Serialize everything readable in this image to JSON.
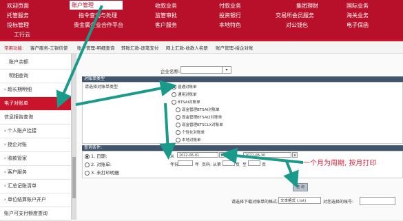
{
  "topnav": {
    "items": [
      {
        "label": "欢迎页面"
      },
      {
        "label": "账户管理"
      },
      {
        "label": "收款业务"
      },
      {
        "label": "付款业务"
      },
      {
        "label": "集团理财"
      },
      {
        "label": "国际业务"
      },
      {
        "label": "托管服务"
      },
      {
        "label": "指令查询与处理"
      },
      {
        "label": "监管审批"
      },
      {
        "label": "投资银行"
      },
      {
        "label": "交易所会员服务"
      },
      {
        "label": "海关业务"
      },
      {
        "label": "投标管理"
      },
      {
        "label": "贵金属企业合作平台"
      },
      {
        "label": "客户服务"
      },
      {
        "label": "本地特色"
      },
      {
        "label": "对公钱包"
      },
      {
        "label": "电子保函"
      },
      {
        "label": "工行云"
      }
    ]
  },
  "quickbar": {
    "label": "常用功能:",
    "items": [
      "客户服务-工银信使",
      "账户管理-明细查询",
      "转账汇款-逐笔支付",
      "网上汇款-收款人名册",
      "账户管理-授企对账"
    ]
  },
  "sidebar": {
    "items": [
      {
        "label": "账户余额",
        "active": false
      },
      {
        "label": "明细查询",
        "active": false
      },
      {
        "label": "› 超长期明细",
        "active": false
      },
      {
        "label": "电子对账单",
        "active": true
      },
      {
        "label": "信息报告查询",
        "active": false
      },
      {
        "label": "› 个人账户挂接",
        "active": false
      },
      {
        "label": "› 授企对账",
        "active": false
      },
      {
        "label": "› 收款管家",
        "active": false
      },
      {
        "label": "› 客户服务",
        "active": false
      },
      {
        "label": "› 汇总记账清单",
        "active": false
      },
      {
        "label": "› 单位结算账户开户",
        "active": false
      },
      {
        "label": "账户可支付额度查询",
        "active": false
      }
    ]
  },
  "account": {
    "label": "企业名称:"
  },
  "statement_type": {
    "header": "对账单类型",
    "label": "请选择对账单类型",
    "options": [
      {
        "label": "普通对账单",
        "checked": true
      },
      {
        "label": "通用对账单",
        "checked": false
      },
      {
        "label": "BTSAI对账单",
        "checked": false
      },
      {
        "label": "现金管理BTSAI对账单",
        "checked": false
      },
      {
        "label": "现金管理BTSAI2对账单",
        "checked": false
      },
      {
        "label": "现金管理BTSCLX对账单",
        "checked": false
      },
      {
        "label": "个性化对账单",
        "checked": false
      },
      {
        "label": "本地对账单",
        "checked": false
      }
    ]
  },
  "query": {
    "header": "查询条件:",
    "by_date_label": "1. 日期:",
    "from_label": "从",
    "from_value": "2022-06-01",
    "to_label": "至",
    "to_value": "2022-06-30",
    "by_statement_label": "2. 对账单:",
    "year_label": "年份",
    "year_unit": "年",
    "page_label": "页码: 从第",
    "page_unit": "页",
    "page_to_label": "至",
    "unprinted_label": "3. 未打印明细"
  },
  "annotation": "一个月为周期, 按月打印",
  "query_button": "查 询",
  "download": {
    "label": "请选择下载对账单的格式:",
    "format_value": "文本格式 (.txt)",
    "email_label": "对您选择的账号:"
  }
}
